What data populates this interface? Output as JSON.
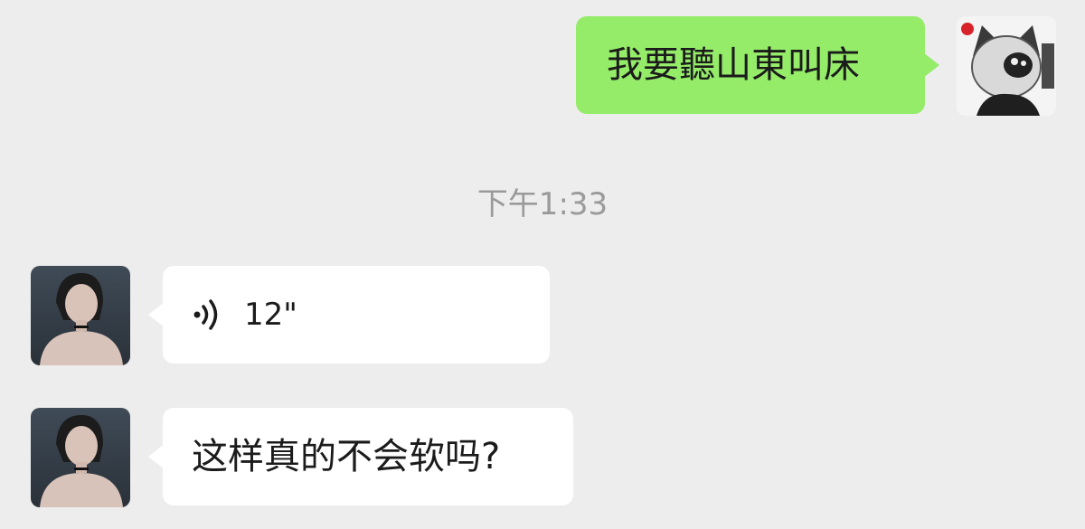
{
  "messages": [
    {
      "side": "right",
      "type": "text",
      "text": "我要聽山東叫床"
    },
    {
      "side": "left",
      "type": "voice",
      "duration": "12\""
    },
    {
      "side": "left",
      "type": "text",
      "text": "这样真的不会软吗?"
    }
  ],
  "timestamp": "下午1:33",
  "colors": {
    "background": "#ededed",
    "self_bubble": "#95ec69",
    "other_bubble": "#ffffff",
    "timestamp_text": "#9a9a9a"
  },
  "icons": {
    "voice": "voice-wave-icon"
  }
}
